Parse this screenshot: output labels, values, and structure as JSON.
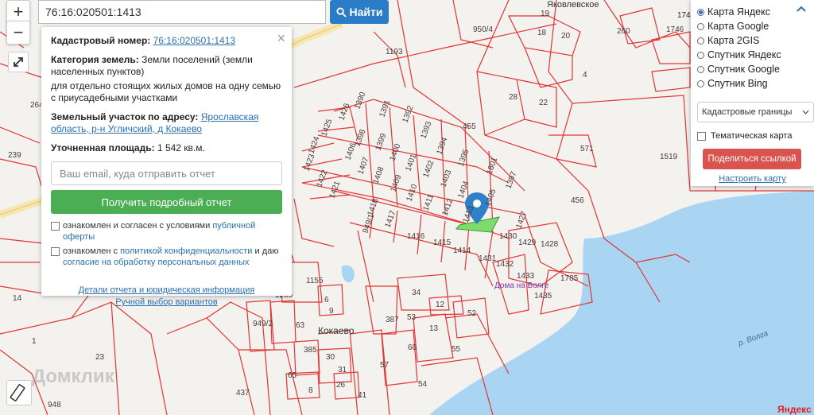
{
  "search": {
    "value": "76:16:020501:1413",
    "button": "Найти"
  },
  "zoom": {
    "in": "+",
    "out": "−"
  },
  "info": {
    "cadastral_label": "Кадастровый номер:",
    "cadastral_value": "76:16:020501:1413",
    "category_label": "Категория земель:",
    "category_value": "Земли поселений (земли населенных пунктов)",
    "purpose": "для отдельно стоящих жилых домов на одну семью с приусадебными участками",
    "address_label": "Земельный участок по адресу:",
    "address_value": "Ярославская область, р-н Угличский, д Кокаево",
    "area_label": "Уточненная площадь:",
    "area_value": "1 542 кв.м.",
    "email_placeholder": "Ваш email, куда отправить отчет",
    "report_button": "Получить подробный отчет",
    "agree1_text": "ознакомлен и согласен с условиями",
    "agree1_link": "публичной оферты",
    "agree2_text": "ознакомлен с",
    "agree2_link": "политикой конфиденциальности",
    "agree2_mid": "и даю",
    "agree2_link2": "согласие на обработку персональных данных",
    "details_link": "Детали отчета и юридическая информация",
    "manual_link": "Ручной выбор вариантов",
    "close": "×"
  },
  "layers": {
    "options": [
      {
        "label": "Карта Яндекс",
        "selected": true
      },
      {
        "label": "Карта Google",
        "selected": false
      },
      {
        "label": "Карта 2GIS",
        "selected": false
      },
      {
        "label": "Спутник Яндекс",
        "selected": false
      },
      {
        "label": "Спутник Google",
        "selected": false
      },
      {
        "label": "Спутник Bing",
        "selected": false
      }
    ],
    "select_value": "Кадастровые границы",
    "thematic": "Тематическая карта",
    "share_button": "Поделиться ссылкой",
    "configure_link": "Настроить карту"
  },
  "map": {
    "places": [
      "Кокаево",
      "Дома на Волге",
      "р. Волга",
      "Яковлевское"
    ],
    "selected_parcel": "1413",
    "parcels": [
      "1193",
      "1390",
      "1391",
      "1392",
      "1393",
      "1394",
      "1395",
      "1801",
      "1397",
      "1398",
      "1399",
      "1400",
      "1401",
      "1402",
      "1403",
      "1404",
      "1405",
      "1406",
      "1407",
      "1408",
      "1409",
      "1410",
      "1411",
      "1412",
      "1413",
      "1414",
      "1415",
      "1416",
      "1417",
      "1418",
      "1421",
      "1422",
      "1423",
      "1424",
      "1425",
      "1426",
      "1427",
      "1428",
      "1429",
      "1430",
      "1431",
      "1432",
      "1433",
      "1435",
      "1785",
      "455",
      "456",
      "571",
      "1519",
      "28",
      "22",
      "4",
      "18",
      "19",
      "20",
      "260",
      "1746",
      "1747",
      "950/4",
      "264",
      "239",
      "14",
      "1",
      "23",
      "437",
      "948",
      "1155",
      "1205",
      "949/1",
      "949/2",
      "63",
      "385",
      "30",
      "31",
      "26",
      "65",
      "41",
      "57",
      "60",
      "55",
      "54",
      "34",
      "12",
      "52",
      "13",
      "53",
      "387",
      "1747",
      "8",
      "6",
      "9"
    ],
    "watermark": "Домклик",
    "attribution": "Яндекс"
  },
  "colors": {
    "boundary": "#e03535",
    "water": "#a9d4f2",
    "selected": "#7ddc6a",
    "pin": "#2f7fc9"
  }
}
